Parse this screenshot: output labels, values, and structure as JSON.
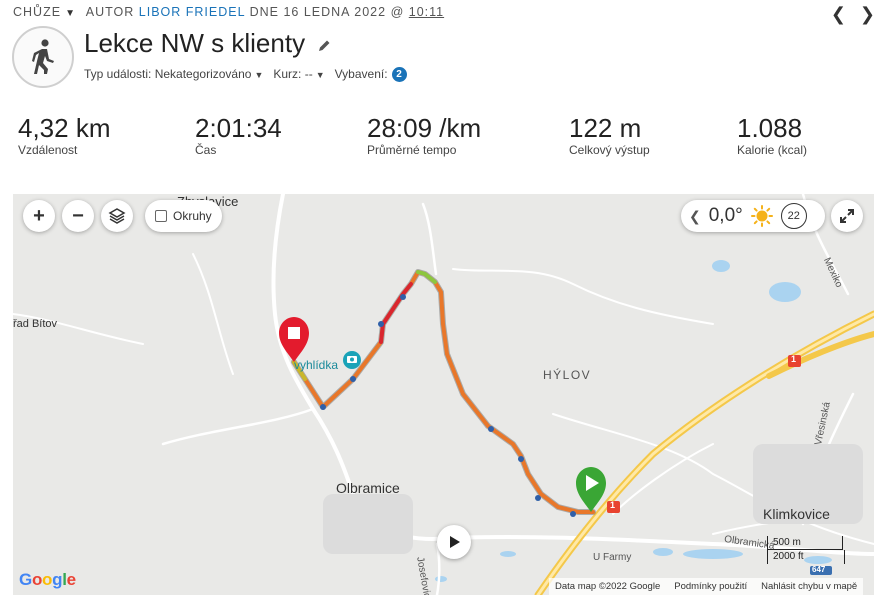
{
  "header": {
    "activity_type": "CHŮZE",
    "author_prefix": "AUTOR",
    "author_name": "LIBOR FRIEDEL",
    "date_text": "DNE 16 LEDNA 2022 @",
    "time_text": "10:11",
    "title": "Lekce NW s klienty",
    "event_type": "Typ události: Nekategorizováno",
    "course": "Kurz: --",
    "gear_label": "Vybavení:",
    "gear_count": "2"
  },
  "stats": [
    {
      "value": "4,32 km",
      "label": "Vzdálenost"
    },
    {
      "value": "2:01:34",
      "label": "Čas"
    },
    {
      "value": "28:09 /km",
      "label": "Průměrné tempo"
    },
    {
      "value": "122 m",
      "label": "Celkový výstup"
    },
    {
      "value": "1.088",
      "label": "Kalorie (kcal)"
    }
  ],
  "map": {
    "okruhy_label": "Okruhy",
    "weather_temp": "0,0°",
    "wind_speed": "22",
    "labels": {
      "zbyslavice": "Zbyslavice",
      "urad_bitov": "řad Bítov",
      "vyhlidka": "vyhlídka",
      "hylov": "HÝLOV",
      "olbramice": "Olbramice",
      "klimkovice": "Klimkovice",
      "mexiko": "Mexiko",
      "viesinska": "Vřesinská",
      "u_farmy": "U Farmy",
      "josefovice": "Josefovic",
      "olbramicka": "Olbramická",
      "road_1a": "1",
      "road_1b": "1",
      "road_647": "647"
    },
    "scale_metric": "500 m",
    "scale_imperial": "2000 ft",
    "google_logo": "Google",
    "attribution": "Data map ©2022 Google",
    "terms": "Podmínky použití",
    "report": "Nahlásit chybu v mapě"
  },
  "colors": {
    "accent": "#1a73b8",
    "route_orange": "#e8772a",
    "route_red": "#d9262e",
    "start_green": "#3aa635",
    "end_red": "#e31b2d"
  }
}
